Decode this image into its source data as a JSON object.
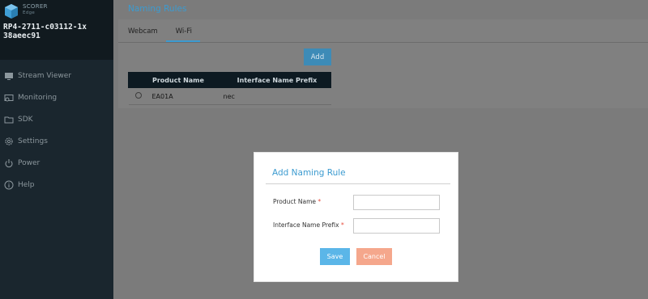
{
  "sidebar": {
    "brand_name": "SCORER",
    "brand_sub": "Edge",
    "device_line1": "RP4-2711-c03112-1x",
    "device_line2": "38aeec91",
    "items": [
      {
        "label": "Stream Viewer",
        "icon": "monitor-icon"
      },
      {
        "label": "Monitoring",
        "icon": "monitoring-icon"
      },
      {
        "label": "SDK",
        "icon": "folder-icon"
      },
      {
        "label": "Settings",
        "icon": "gear-icon"
      },
      {
        "label": "Power",
        "icon": "power-icon"
      },
      {
        "label": "Help",
        "icon": "info-icon"
      }
    ]
  },
  "header": {
    "title": "Naming Rules"
  },
  "tabs": [
    {
      "label": "Webcam",
      "active": false
    },
    {
      "label": "Wi-Fi",
      "active": true
    }
  ],
  "toolbar": {
    "add_label": "Add"
  },
  "table": {
    "columns": [
      "",
      "Product Name",
      "Interface Name Prefix"
    ],
    "rows": [
      {
        "product_name": "EA01A",
        "prefix": "nec"
      }
    ]
  },
  "modal": {
    "title": "Add Naming Rule",
    "fields": [
      {
        "label": "Product Name",
        "required_mark": "*",
        "value": ""
      },
      {
        "label": "Interface Name Prefix",
        "required_mark": "*",
        "value": ""
      }
    ],
    "save_label": "Save",
    "cancel_label": "Cancel"
  },
  "colors": {
    "accent": "#3c9bd0",
    "sidebar_bg": "#1a262e",
    "save": "#5bb6e8",
    "cancel": "#f5a78c",
    "required": "#e74c3c"
  }
}
